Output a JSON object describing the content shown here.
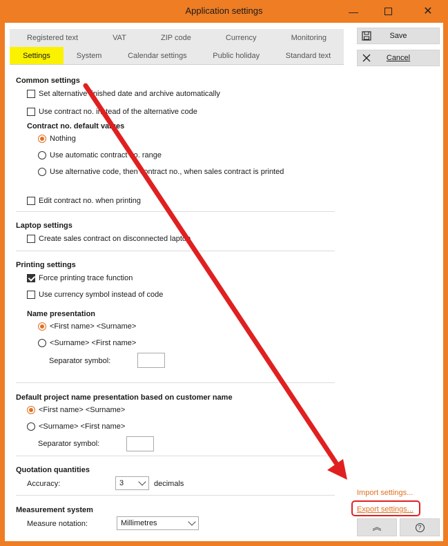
{
  "window": {
    "title": "Application settings",
    "minimize_icon": "minimize-icon",
    "maximize_icon": "maximize-icon",
    "close_icon": "close-icon",
    "close_glyph": "✕",
    "minimize_glyph": "—"
  },
  "tabs": {
    "row1": [
      "Registered text",
      "VAT",
      "ZIP code",
      "Currency",
      "Monitoring"
    ],
    "row2": [
      "Settings",
      "System",
      "Calendar settings",
      "Public holiday",
      "Standard text"
    ],
    "active": "Settings"
  },
  "actions": {
    "save_label": "Save",
    "cancel_label": "Cancel",
    "import_label": "Import settings...",
    "export_label": "Export settings...",
    "up_glyph": "︽",
    "help_glyph": "?"
  },
  "common": {
    "title": "Common settings",
    "alt_finished": "Set alternative finished date and archive automatically",
    "use_contract_no": "Use contract no. instead of the alternative code",
    "contract_defaults_title": "Contract no. default values",
    "opt_nothing": "Nothing",
    "opt_auto_range": "Use automatic contract no. range",
    "opt_alt_code": "Use alternative code, then contract no., when sales contract is printed",
    "edit_when_printing": "Edit contract no. when printing"
  },
  "laptop": {
    "title": "Laptop settings",
    "create_disconnected": "Create sales contract on disconnected laptop"
  },
  "printing": {
    "title": "Printing settings",
    "force_trace": "Force printing trace function",
    "currency_symbol": "Use currency symbol instead of code",
    "name_presentation_title": "Name presentation",
    "opt_first_sur": "<First name> <Surname>",
    "opt_sur_first": "<Surname> <First name>",
    "separator_label": "Separator symbol:"
  },
  "project_name": {
    "title": "Default project name presentation based on customer name",
    "opt_first_sur": "<First name> <Surname>",
    "opt_sur_first": "<Surname> <First name>",
    "separator_label": "Separator symbol:"
  },
  "quotation": {
    "title": "Quotation quantities",
    "accuracy_label": "Accuracy:",
    "accuracy_value": "3",
    "decimals_label": "decimals"
  },
  "measurement": {
    "title": "Measurement system",
    "notation_label": "Measure notation:",
    "notation_value": "Millimetres"
  },
  "colors": {
    "frame": "#ee7d24",
    "active_tab": "#fbf200",
    "link": "#e07020",
    "annotation": "#e02020"
  }
}
